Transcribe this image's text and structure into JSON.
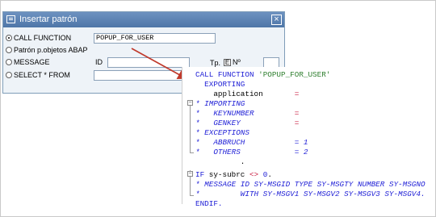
{
  "dialog": {
    "title": "Insertar patrón",
    "close_glyph": "×",
    "options": [
      {
        "label": "CALL FUNCTION",
        "checked": true
      },
      {
        "label": "Patrón p.objetos ABAP",
        "checked": false
      },
      {
        "label": "MESSAGE",
        "checked": false
      },
      {
        "label": "SELECT * FROM",
        "checked": false
      }
    ],
    "call_function_value": "POPUP_FOR_USER",
    "message_id_label": "ID",
    "message_id_value": "",
    "message_type_label": "Tp.",
    "message_type_value": "E",
    "message_number_label": "Nº",
    "message_number_value": "",
    "select_value": ""
  },
  "code": {
    "lines": [
      {
        "parts": [
          [
            "kw",
            "CALL FUNCTION "
          ],
          [
            "str",
            "'POPUP_FOR_USER'"
          ]
        ],
        "indent": 0
      },
      {
        "parts": [
          [
            "kw",
            "EXPORTING"
          ]
        ],
        "indent": 2
      },
      {
        "parts": [
          [
            "plain",
            "application       "
          ],
          [
            "op",
            "="
          ]
        ],
        "indent": 4
      },
      {
        "parts": [
          [
            "cmt",
            "* IMPORTING"
          ]
        ],
        "indent": 0
      },
      {
        "parts": [
          [
            "cmt",
            "*   KEYNUMBER         "
          ],
          [
            "op",
            "="
          ]
        ],
        "indent": 0
      },
      {
        "parts": [
          [
            "cmt",
            "*   GENKEY            "
          ],
          [
            "op",
            "="
          ]
        ],
        "indent": 0
      },
      {
        "parts": [
          [
            "cmt",
            "* EXCEPTIONS"
          ]
        ],
        "indent": 0
      },
      {
        "parts": [
          [
            "cmt",
            "*   ABBRUCH           = 1"
          ]
        ],
        "indent": 0
      },
      {
        "parts": [
          [
            "cmt",
            "*   OTHERS            = 2"
          ]
        ],
        "indent": 0
      },
      {
        "parts": [
          [
            "plain",
            "          ."
          ]
        ],
        "indent": 0
      },
      {
        "parts": [
          [
            "kw",
            "IF "
          ],
          [
            "plain",
            "sy-subrc "
          ],
          [
            "op",
            "<>"
          ],
          [
            "plain",
            " "
          ],
          [
            "num",
            "0"
          ],
          [
            "plain",
            "."
          ]
        ],
        "indent": 0
      },
      {
        "parts": [
          [
            "cmt",
            "* MESSAGE ID SY-MSGID TYPE SY-MSGTY NUMBER SY-MSGNO"
          ]
        ],
        "indent": 0
      },
      {
        "parts": [
          [
            "cmt",
            "*         WITH SY-MSGV1 SY-MSGV2 SY-MSGV3 SY-MSGV4."
          ]
        ],
        "indent": 0
      },
      {
        "parts": [
          [
            "kw",
            "ENDIF."
          ]
        ],
        "indent": 0
      }
    ]
  },
  "colors": {
    "keyword": "#1f1fd6",
    "string": "#2f7f2f",
    "operator": "#c8183c",
    "arrow": "#c0392b",
    "title_bar": "#5a80b2"
  }
}
